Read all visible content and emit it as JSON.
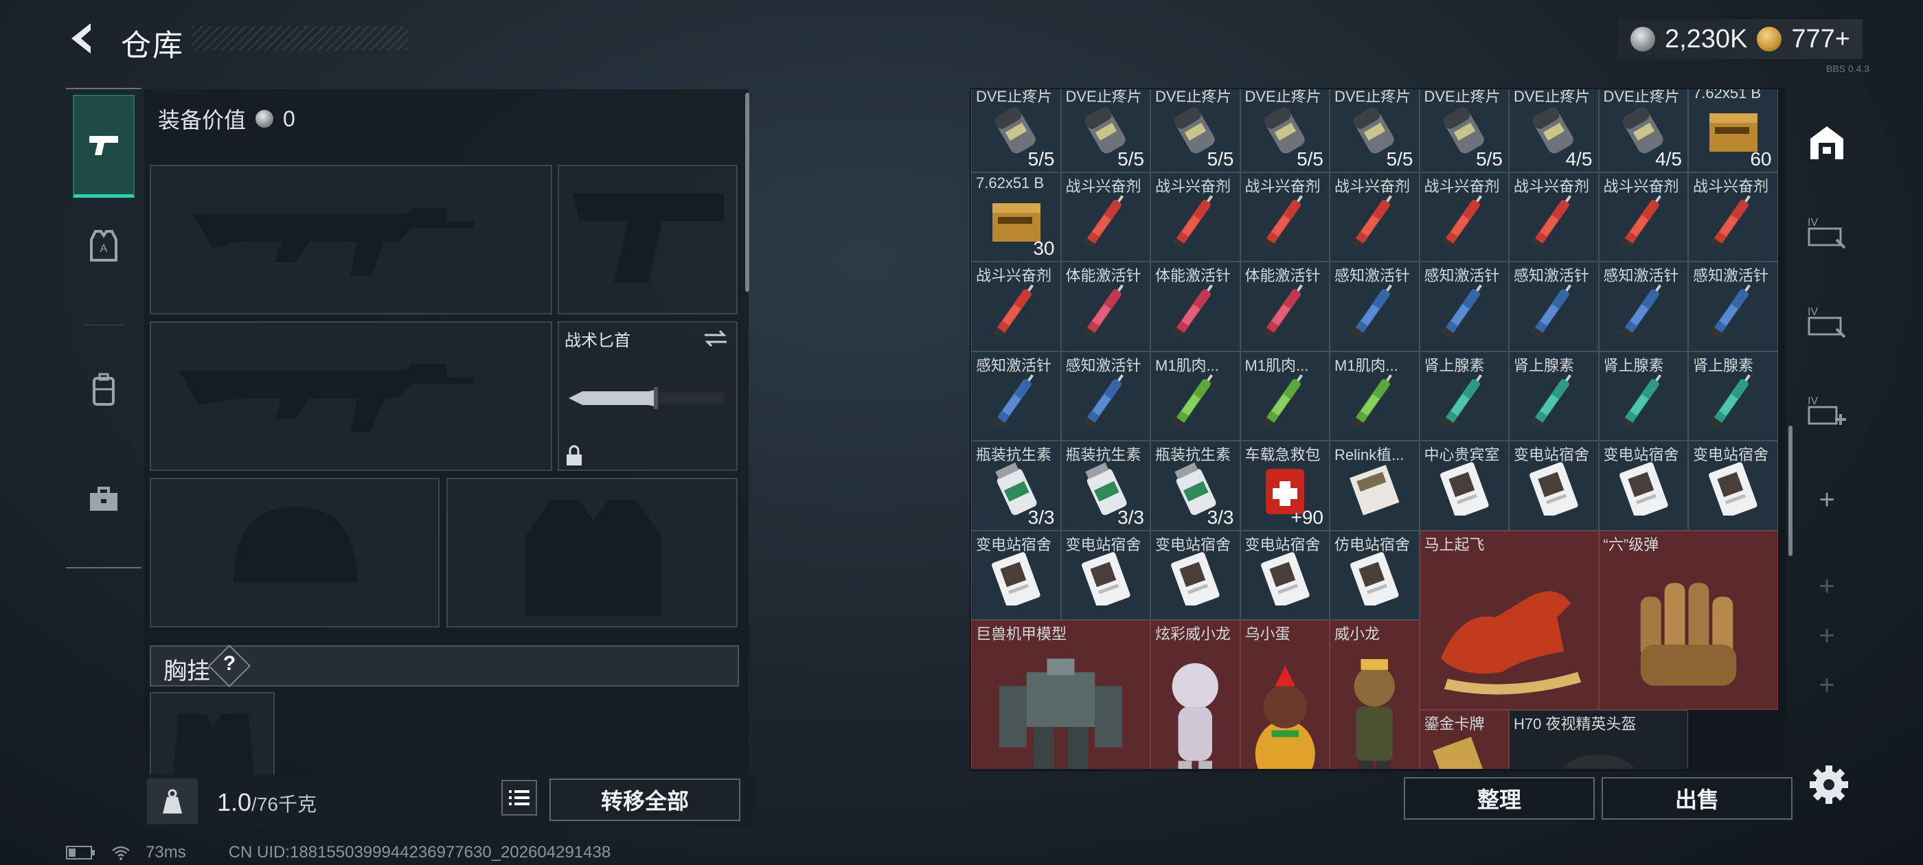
{
  "header": {
    "title": "仓库"
  },
  "currency": {
    "silver": "2,230K",
    "gold": "777+"
  },
  "version_tiny": "BBS 0.4.3",
  "equipment": {
    "value_label": "装备价值",
    "value": "0",
    "melee_label": "战术匕首",
    "chest_label": "胸挂",
    "help": "?"
  },
  "bottom_left": {
    "weight_value": "1.0",
    "weight_max": "/76千克",
    "transfer_all": "转移全部"
  },
  "bottom_right": {
    "sort": "整理",
    "sell": "出售"
  },
  "status": {
    "ping": "73ms",
    "uid": "CN UID:1881550399944236977630_202604291438"
  },
  "storage_rows": [
    [
      {
        "n": "DVE止疼片",
        "c": "5/5",
        "k": "pill"
      },
      {
        "n": "DVE止疼片",
        "c": "5/5",
        "k": "pill"
      },
      {
        "n": "DVE止疼片",
        "c": "5/5",
        "k": "pill"
      },
      {
        "n": "DVE止疼片",
        "c": "5/5",
        "k": "pill"
      },
      {
        "n": "DVE止疼片",
        "c": "5/5",
        "k": "pill"
      },
      {
        "n": "DVE止疼片",
        "c": "5/5",
        "k": "pill"
      },
      {
        "n": "DVE止疼片",
        "c": "4/5",
        "k": "pill"
      },
      {
        "n": "DVE止疼片",
        "c": "4/5",
        "k": "pill"
      },
      {
        "n": "7.62x51 B",
        "c": "60",
        "k": "ammo"
      }
    ],
    [
      {
        "n": "7.62x51 B",
        "c": "30",
        "k": "ammo"
      },
      {
        "n": "战斗兴奋剂",
        "c": "",
        "k": "syr-red"
      },
      {
        "n": "战斗兴奋剂",
        "c": "",
        "k": "syr-red"
      },
      {
        "n": "战斗兴奋剂",
        "c": "",
        "k": "syr-red"
      },
      {
        "n": "战斗兴奋剂",
        "c": "",
        "k": "syr-red"
      },
      {
        "n": "战斗兴奋剂",
        "c": "",
        "k": "syr-red"
      },
      {
        "n": "战斗兴奋剂",
        "c": "",
        "k": "syr-red"
      },
      {
        "n": "战斗兴奋剂",
        "c": "",
        "k": "syr-red"
      },
      {
        "n": "战斗兴奋剂",
        "c": "",
        "k": "syr-red"
      }
    ],
    [
      {
        "n": "战斗兴奋剂",
        "c": "",
        "k": "syr-red"
      },
      {
        "n": "体能激活针",
        "c": "",
        "k": "syr-pink"
      },
      {
        "n": "体能激活针",
        "c": "",
        "k": "syr-pink"
      },
      {
        "n": "体能激活针",
        "c": "",
        "k": "syr-pink"
      },
      {
        "n": "感知激活针",
        "c": "",
        "k": "syr-blue"
      },
      {
        "n": "感知激活针",
        "c": "",
        "k": "syr-blue"
      },
      {
        "n": "感知激活针",
        "c": "",
        "k": "syr-blue"
      },
      {
        "n": "感知激活针",
        "c": "",
        "k": "syr-blue"
      },
      {
        "n": "感知激活针",
        "c": "",
        "k": "syr-blue"
      }
    ],
    [
      {
        "n": "感知激活针",
        "c": "",
        "k": "syr-blue"
      },
      {
        "n": "感知激活针",
        "c": "",
        "k": "syr-blue"
      },
      {
        "n": "M1肌肉...",
        "c": "",
        "k": "syr-green"
      },
      {
        "n": "M1肌肉...",
        "c": "",
        "k": "syr-green"
      },
      {
        "n": "M1肌肉...",
        "c": "",
        "k": "syr-green"
      },
      {
        "n": "肾上腺素",
        "c": "",
        "k": "syr-teal"
      },
      {
        "n": "肾上腺素",
        "c": "",
        "k": "syr-teal"
      },
      {
        "n": "肾上腺素",
        "c": "",
        "k": "syr-teal"
      },
      {
        "n": "肾上腺素",
        "c": "",
        "k": "syr-teal"
      }
    ],
    [
      {
        "n": "瓶装抗生素",
        "c": "3/3",
        "k": "bottle"
      },
      {
        "n": "瓶装抗生素",
        "c": "3/3",
        "k": "bottle"
      },
      {
        "n": "瓶装抗生素",
        "c": "3/3",
        "k": "bottle"
      },
      {
        "n": "车载急救包",
        "c": "+90",
        "k": "medkit"
      },
      {
        "n": "Relink植...",
        "c": "",
        "k": "chip"
      },
      {
        "n": "中心贵宾室",
        "c": "",
        "k": "card"
      },
      {
        "n": "变电站宿舍",
        "c": "",
        "k": "card"
      },
      {
        "n": "变电站宿舍",
        "c": "",
        "k": "card"
      },
      {
        "n": "变电站宿舍",
        "c": "",
        "k": "card"
      }
    ],
    [
      {
        "n": "变电站宿舍",
        "c": "",
        "k": "card"
      },
      {
        "n": "变电站宿舍",
        "c": "",
        "k": "card"
      },
      {
        "n": "变电站宿舍",
        "c": "",
        "k": "card"
      },
      {
        "n": "变电站宿舍",
        "c": "",
        "k": "card"
      },
      {
        "n": "仿电站宿舍",
        "c": "",
        "k": "card"
      }
    ]
  ],
  "big_items": [
    {
      "n": "马上起飞",
      "k": "horse"
    },
    {
      "n": "“六”级弹",
      "k": "fist"
    },
    {
      "n": "巨兽机甲模型",
      "k": "mech"
    },
    {
      "n": "炫彩威小龙",
      "k": "toy"
    },
    {
      "n": "乌小蛋",
      "k": "egg"
    },
    {
      "n": "威小龙",
      "k": "figure"
    },
    {
      "n": "鎏金卡牌",
      "k": "goldcard"
    },
    {
      "n": "H70 夜视精英头盔",
      "k": "helmet"
    }
  ],
  "tools": {
    "filter1": "IV",
    "filter2": "IV",
    "filter3": "IV"
  }
}
